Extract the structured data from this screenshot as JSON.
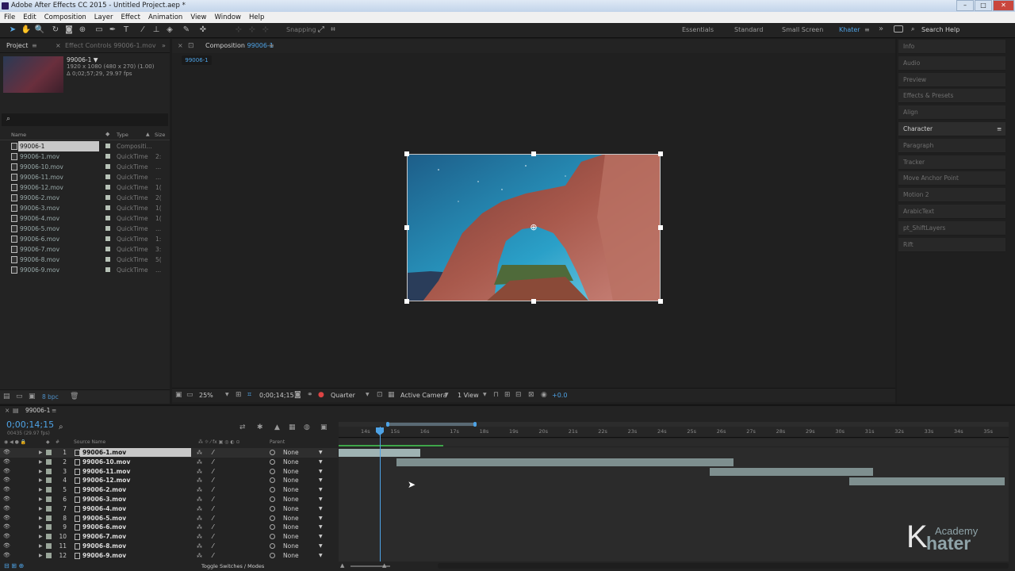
{
  "window": {
    "title": "Adobe After Effects CC 2015 - Untitled Project.aep *"
  },
  "menu": [
    "File",
    "Edit",
    "Composition",
    "Layer",
    "Effect",
    "Animation",
    "View",
    "Window",
    "Help"
  ],
  "toolbar": {
    "snapping": "Snapping",
    "workspaces": [
      "Essentials",
      "Standard",
      "Small Screen",
      "Khater"
    ],
    "search": "Search Help"
  },
  "project": {
    "tab": "Project",
    "tab2": "Effect Controls 99006-1.mov",
    "comp_name": "99006-1 ▼",
    "comp_info1": "1920 x 1080  (480 x 270) (1.00)",
    "comp_info2": "Δ 0;02;57;29, 29.97 fps",
    "col_name": "Name",
    "col_type": "Type",
    "col_size": "Size",
    "items": [
      {
        "name": "99006-1",
        "type": "Compositi...",
        "size": ""
      },
      {
        "name": "99006-1.mov",
        "type": "QuickTime",
        "size": "2:"
      },
      {
        "name": "99006-10.mov",
        "type": "QuickTime",
        "size": "..."
      },
      {
        "name": "99006-11.mov",
        "type": "QuickTime",
        "size": "..."
      },
      {
        "name": "99006-12.mov",
        "type": "QuickTime",
        "size": "1("
      },
      {
        "name": "99006-2.mov",
        "type": "QuickTime",
        "size": "2("
      },
      {
        "name": "99006-3.mov",
        "type": "QuickTime",
        "size": "1("
      },
      {
        "name": "99006-4.mov",
        "type": "QuickTime",
        "size": "1("
      },
      {
        "name": "99006-5.mov",
        "type": "QuickTime",
        "size": "..."
      },
      {
        "name": "99006-6.mov",
        "type": "QuickTime",
        "size": "1:"
      },
      {
        "name": "99006-7.mov",
        "type": "QuickTime",
        "size": "3:"
      },
      {
        "name": "99006-8.mov",
        "type": "QuickTime",
        "size": "5("
      },
      {
        "name": "99006-9.mov",
        "type": "QuickTime",
        "size": "..."
      }
    ],
    "bpc": "8 bpc"
  },
  "comp": {
    "tab_prefix": "Composition",
    "tab_name": "99006-1",
    "chip": "99006-1",
    "zoom": "25%",
    "timecode": "0;00;14;15",
    "resolution": "Quarter",
    "camera": "Active Camera",
    "views": "1 View",
    "exposure": "+0.0"
  },
  "right_panels": [
    "Info",
    "Audio",
    "Preview",
    "Effects & Presets",
    "Align",
    "Character",
    "Paragraph",
    "Tracker",
    "Move Anchor Point",
    "Motion 2",
    "ArabicText",
    "pt_ShiftLayers",
    "Rift"
  ],
  "timeline": {
    "tab": "99006-1",
    "timecode": "0;00;14;15",
    "fps": "00435 (29.97 fps)",
    "col_source": "Source Name",
    "col_parent": "Parent",
    "toggle": "Toggle Switches / Modes",
    "ticks": [
      "14s",
      "15s",
      "16s",
      "17s",
      "18s",
      "19s",
      "20s",
      "21s",
      "22s",
      "23s",
      "24s",
      "25s",
      "26s",
      "27s",
      "28s",
      "29s",
      "30s",
      "31s",
      "32s",
      "33s",
      "34s",
      "35s"
    ],
    "layers": [
      {
        "n": "1",
        "name": "99006-1.mov",
        "parent": "None"
      },
      {
        "n": "2",
        "name": "99006-10.mov",
        "parent": "None"
      },
      {
        "n": "3",
        "name": "99006-11.mov",
        "parent": "None"
      },
      {
        "n": "4",
        "name": "99006-12.mov",
        "parent": "None"
      },
      {
        "n": "5",
        "name": "99006-2.mov",
        "parent": "None"
      },
      {
        "n": "6",
        "name": "99006-3.mov",
        "parent": "None"
      },
      {
        "n": "7",
        "name": "99006-4.mov",
        "parent": "None"
      },
      {
        "n": "8",
        "name": "99006-5.mov",
        "parent": "None"
      },
      {
        "n": "9",
        "name": "99006-6.mov",
        "parent": "None"
      },
      {
        "n": "10",
        "name": "99006-7.mov",
        "parent": "None"
      },
      {
        "n": "11",
        "name": "99006-8.mov",
        "parent": "None"
      },
      {
        "n": "12",
        "name": "99006-9.mov",
        "parent": "None"
      }
    ]
  },
  "watermark": {
    "big": "K",
    "small1": "Academy",
    "small2": "hater"
  }
}
